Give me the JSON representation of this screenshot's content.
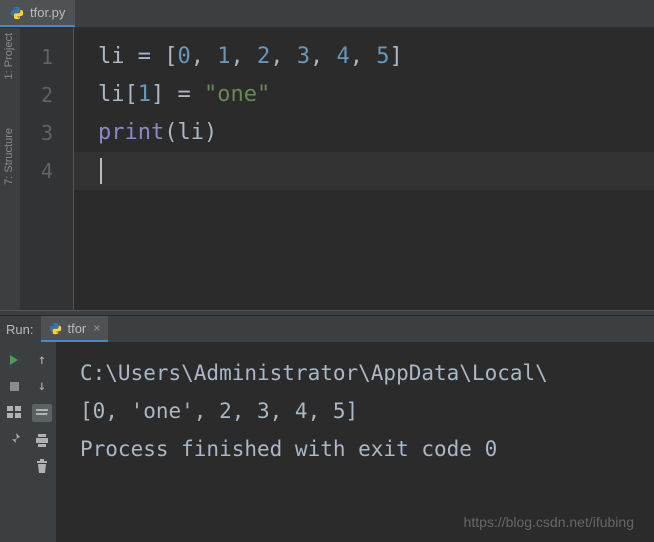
{
  "editor": {
    "tab_name": "tfor.py",
    "line_numbers": [
      "1",
      "2",
      "3",
      "4"
    ],
    "code": {
      "l1": {
        "a": "li ",
        "b": "= [",
        "n0": "0",
        "c": ", ",
        "n1": "1",
        "d": ", ",
        "n2": "2",
        "e": ", ",
        "n3": "3",
        "f": ", ",
        "n4": "4",
        "g": ", ",
        "n5": "5",
        "h": "]"
      },
      "l2": {
        "a": "li[",
        "n": "1",
        "b": "] ",
        "c": "= ",
        "s": "\"one\""
      },
      "l3": {
        "fn": "print",
        "a": "(li)"
      }
    }
  },
  "sidebar": {
    "project": "1: Project",
    "structure": "7: Structure"
  },
  "run": {
    "label": "Run:",
    "tab_name": "tfor",
    "output": {
      "l1": "C:\\Users\\Administrator\\AppData\\Local\\",
      "l2": "[0, 'one', 2, 3, 4, 5]",
      "l3": "",
      "l4": "Process finished with exit code 0"
    }
  },
  "watermark": "https://blog.csdn.net/ifubing"
}
